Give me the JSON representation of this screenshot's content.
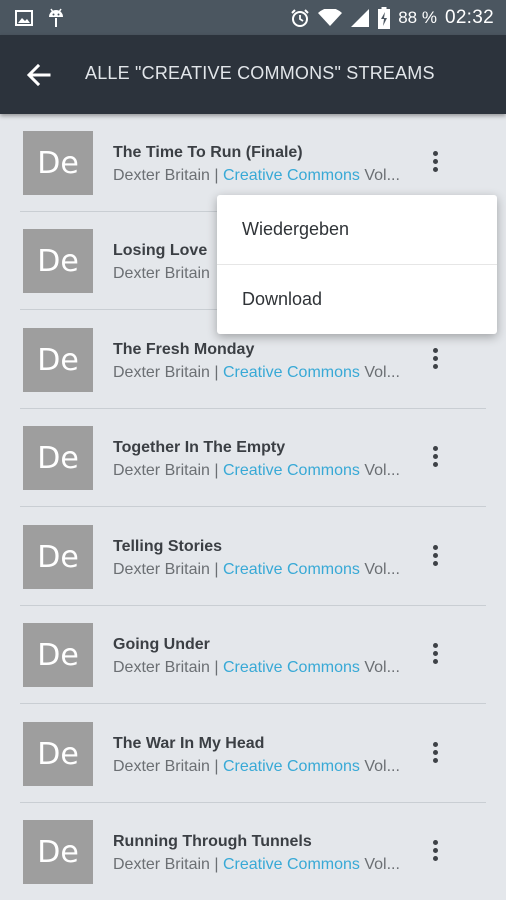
{
  "status_bar": {
    "icons_left": [
      "image-icon",
      "android-icon"
    ],
    "icons_right": [
      "alarm-icon",
      "wifi-icon",
      "signal-icon",
      "battery-charging-icon"
    ],
    "battery": "88 %",
    "time": "02:32"
  },
  "app_bar": {
    "back_icon": "arrow-back-icon",
    "title": "ALLE \"CREATIVE COMMONS\" STREAMS"
  },
  "tracks": [
    {
      "thumb": "De",
      "title": "The Time To Run (Finale)",
      "artist": "Dexter Britain",
      "sep": " | ",
      "label": "Creative Commons",
      "suffix": " Vol..."
    },
    {
      "thumb": "De",
      "title": "Losing Love",
      "artist": "Dexter Britain",
      "sep": "",
      "label": "",
      "suffix": ""
    },
    {
      "thumb": "De",
      "title": "The Fresh Monday",
      "artist": "Dexter Britain",
      "sep": " | ",
      "label": "Creative Commons",
      "suffix": " Vol..."
    },
    {
      "thumb": "De",
      "title": "Together In The Empty",
      "artist": "Dexter Britain",
      "sep": " | ",
      "label": "Creative Commons",
      "suffix": " Vol..."
    },
    {
      "thumb": "De",
      "title": "Telling Stories",
      "artist": "Dexter Britain",
      "sep": " | ",
      "label": "Creative Commons",
      "suffix": " Vol..."
    },
    {
      "thumb": "De",
      "title": "Going Under",
      "artist": "Dexter Britain",
      "sep": " | ",
      "label": "Creative Commons",
      "suffix": " Vol..."
    },
    {
      "thumb": "De",
      "title": "The War In My Head",
      "artist": "Dexter Britain",
      "sep": " | ",
      "label": "Creative Commons",
      "suffix": " Vol..."
    },
    {
      "thumb": "De",
      "title": "Running Through Tunnels",
      "artist": "Dexter Britain",
      "sep": " | ",
      "label": "Creative Commons",
      "suffix": " Vol..."
    }
  ],
  "more_icon": "more-vert-icon",
  "popup_menu": {
    "items": [
      "Wiedergeben",
      "Download"
    ]
  },
  "colors": {
    "status_bar": "#4b5660",
    "app_bar": "#2c333c",
    "background": "#e4e7eb",
    "thumbnail": "#9e9e9e",
    "accent_link": "#38a9d6"
  }
}
